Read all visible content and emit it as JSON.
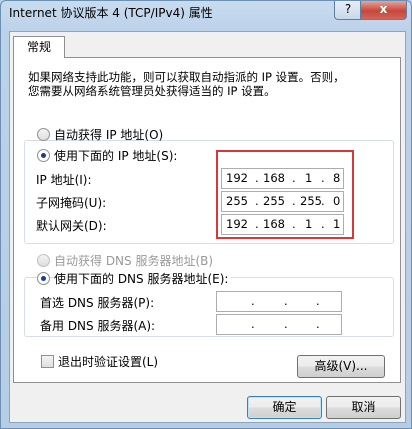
{
  "window": {
    "title": "Internet 协议版本 4 (TCP/IPv4) 属性",
    "help_label": "?",
    "close_label": "x"
  },
  "tabs": [
    {
      "label": "常规"
    }
  ],
  "description": {
    "line1": "如果网络支持此功能，则可以获取自动指派的 IP 设置。否则，",
    "line2": "您需要从网络系统管理员处获得适当的 IP 设置。"
  },
  "ip_section": {
    "auto_label": "自动获得 IP 地址(O)",
    "manual_label": "使用下面的 IP 地址(S):",
    "selected": "manual",
    "fields": [
      {
        "label": "IP 地址(I):",
        "octets": [
          "192",
          "168",
          "1",
          "8"
        ]
      },
      {
        "label": "子网掩码(U):",
        "octets": [
          "255",
          "255",
          "255",
          "0"
        ]
      },
      {
        "label": "默认网关(D):",
        "octets": [
          "192",
          "168",
          "1",
          "1"
        ]
      }
    ]
  },
  "dns_section": {
    "auto_label": "自动获得 DNS 服务器地址(B)",
    "manual_label": "使用下面的 DNS 服务器地址(E):",
    "selected": "manual",
    "fields": [
      {
        "label": "首选 DNS 服务器(P):",
        "octets": [
          "",
          "",
          "",
          ""
        ]
      },
      {
        "label": "备用 DNS 服务器(A):",
        "octets": [
          "",
          "",
          "",
          ""
        ]
      }
    ]
  },
  "validate_on_exit": {
    "label": "退出时验证设置(L)",
    "checked": false
  },
  "buttons": {
    "advanced": "高级(V)...",
    "ok": "确定",
    "cancel": "取消"
  },
  "colors": {
    "highlight_box": "#d43a3a",
    "radio_dot": "#1b3f8f"
  }
}
